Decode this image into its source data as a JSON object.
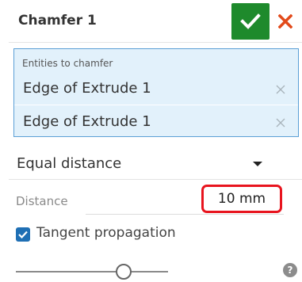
{
  "dialog": {
    "title": "Chamfer 1"
  },
  "entities": {
    "label": "Entities to chamfer",
    "items": [
      {
        "label": "Edge of Extrude 1"
      },
      {
        "label": "Edge of Extrude 1"
      }
    ]
  },
  "chamfer_type": {
    "selected": "Equal distance"
  },
  "distance": {
    "label": "Distance",
    "value": "10 mm"
  },
  "tangent_propagation": {
    "label": "Tangent propagation",
    "checked": true
  },
  "icons": {
    "accept": "checkmark-icon",
    "cancel": "close-icon",
    "remove": "remove-x-icon",
    "dropdown": "caret-down-icon",
    "help": "help-icon"
  },
  "colors": {
    "accept": "#1e8a2c",
    "cancel": "#e24a1a",
    "selection_fill": "#e2f1fb",
    "selection_border": "#5b9fd6",
    "highlight": "#e8141e",
    "checkbox": "#1f6fb4"
  }
}
